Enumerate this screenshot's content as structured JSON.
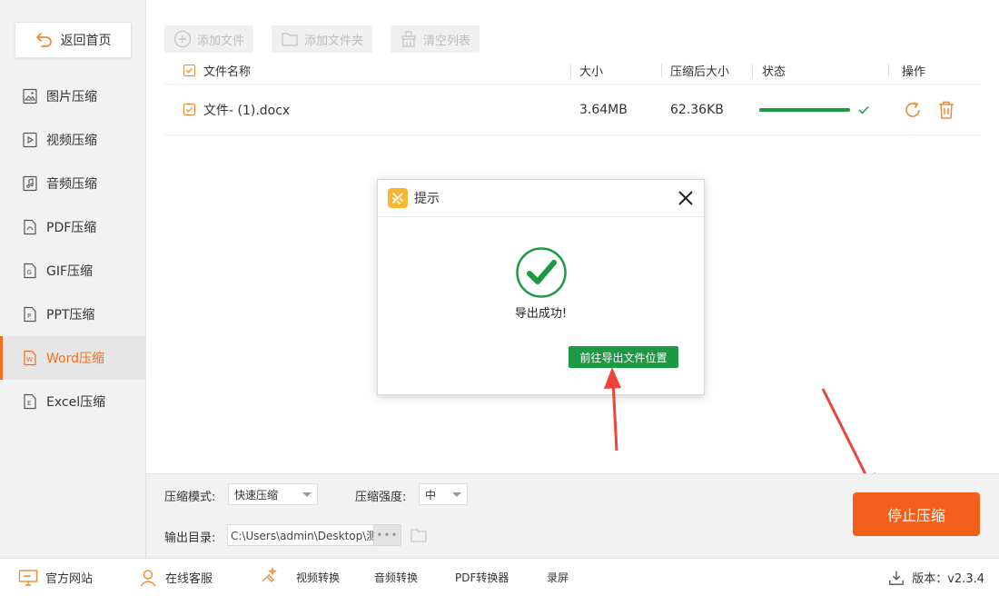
{
  "sidebar": {
    "home_label": "返回首页",
    "items": [
      {
        "label": "图片压缩"
      },
      {
        "label": "视频压缩"
      },
      {
        "label": "音频压缩"
      },
      {
        "label": "PDF压缩"
      },
      {
        "label": "GIF压缩"
      },
      {
        "label": "PPT压缩"
      },
      {
        "label": "Word压缩"
      },
      {
        "label": "Excel压缩"
      }
    ],
    "active_item": "Word压缩"
  },
  "toolbar": {
    "add_file": "添加文件",
    "add_folder": "添加文件夹",
    "clear_list": "清空列表"
  },
  "table": {
    "headers": {
      "name": "文件名称",
      "size": "大小",
      "compressed_size": "压缩后大小",
      "status": "状态",
      "actions": "操作"
    },
    "rows": [
      {
        "name": "文件- (1).docx",
        "size": "3.64MB",
        "compressed_size": "62.36KB",
        "progress": 1.0,
        "done": true
      }
    ]
  },
  "dialog": {
    "title": "提示",
    "message": "导出成功!",
    "button": "前往导出文件位置"
  },
  "settings": {
    "mode_label": "压缩模式:",
    "mode_value": "快速压缩",
    "strength_label": "压缩强度:",
    "strength_value": "中",
    "output_label": "输出目录:",
    "output_path": "C:\\Users\\admin\\Desktop\\测",
    "browse_label": "•••",
    "stop_button": "停止压缩"
  },
  "footer": {
    "website": "官方网站",
    "support": "在线客服",
    "video_convert": "视频转换",
    "audio_convert": "音频转换",
    "pdf_convert": "PDF转换器",
    "record": "录屏",
    "version_label": "版本：v2.3.4"
  },
  "colors": {
    "accent": "#f46d1b",
    "success": "#1b9a43",
    "arrow": "#f0433a"
  }
}
